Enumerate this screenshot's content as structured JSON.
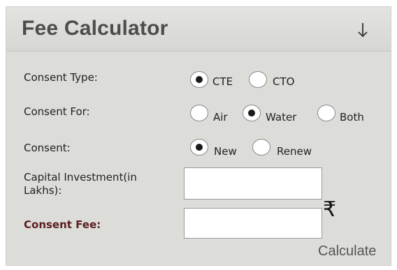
{
  "title": "Fee Calculator",
  "toggle_icon": "arrow-down-icon",
  "consent_type": {
    "label": "Consent Type:",
    "options": [
      {
        "label": "CTE",
        "selected": true
      },
      {
        "label": "CTO",
        "selected": false
      }
    ]
  },
  "consent_for": {
    "label": "Consent For:",
    "options": [
      {
        "label": "Air",
        "selected": false
      },
      {
        "label": "Water",
        "selected": true
      },
      {
        "label": "Both",
        "selected": false
      }
    ]
  },
  "consent": {
    "label": "Consent:",
    "options": [
      {
        "label": "New",
        "selected": true
      },
      {
        "label": "Renew",
        "selected": false
      }
    ]
  },
  "capital_investment": {
    "label_line1": "Capital Investment(in",
    "label_line2": "Lakhs):",
    "value": ""
  },
  "consent_fee": {
    "label": "Consent Fee:",
    "value": "",
    "currency_symbol": "₹"
  },
  "calculate_label": "Calculate",
  "colors": {
    "panel_bg": "#dcdcd8",
    "title_text": "#4d4d4d",
    "fee_label": "#5a1f1f"
  }
}
